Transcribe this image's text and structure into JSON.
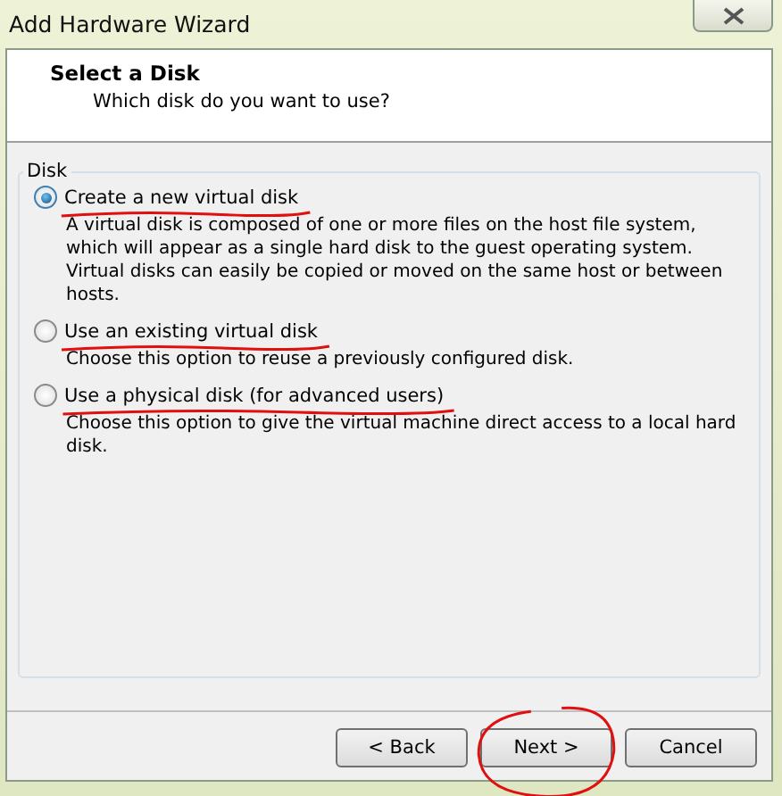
{
  "window": {
    "title": "Add Hardware Wizard"
  },
  "header": {
    "title": "Select a Disk",
    "subtitle": "Which disk do you want to use?"
  },
  "group": {
    "title": "Disk",
    "options": [
      {
        "label": "Create a new virtual disk",
        "description": "A virtual disk is composed of one or more files on the host file system, which will appear as a single hard disk to the guest operating system. Virtual disks can easily be copied or moved on the same host or between hosts.",
        "selected": true
      },
      {
        "label": "Use an existing virtual disk",
        "description": "Choose this option to reuse a previously configured disk.",
        "selected": false
      },
      {
        "label": "Use a physical disk (for advanced users)",
        "description": "Choose this option to give the virtual machine direct access to a local hard disk.",
        "selected": false
      }
    ]
  },
  "buttons": [
    {
      "label": "< Back"
    },
    {
      "label": "Next >"
    },
    {
      "label": "Cancel"
    }
  ]
}
